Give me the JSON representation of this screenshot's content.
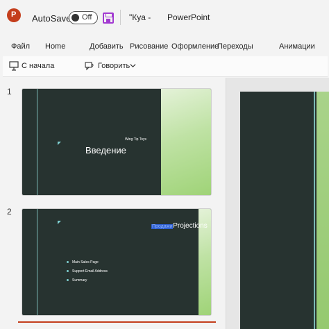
{
  "titlebar": {
    "app_icon": "powerpoint-logo",
    "autosave_label": "AutoSave",
    "autosave_state": "Off",
    "save_icon": "save-icon",
    "document_name": "\"Кya -",
    "app_name": "PowerPoint"
  },
  "ribbon": {
    "tabs": [
      "Файл",
      "Home",
      "Добавить",
      "Рисование",
      "Оформление",
      "Переходы",
      "Анимации"
    ]
  },
  "commands": {
    "from_start": "С начала",
    "speak": "Говорить"
  },
  "slides": [
    {
      "number": "1",
      "title": "Введение",
      "subtitle": "Wing Tip Toys"
    },
    {
      "number": "2",
      "title_highlight": "Продажи",
      "title": "Projections",
      "bullets": [
        "Main Sales Page",
        "Support Email Address",
        "Summary"
      ]
    }
  ],
  "colors": {
    "accent": "#c43e1c",
    "save": "#a23ad1",
    "slide_bg": "#273330",
    "slide_line": "#7ab8b4"
  }
}
